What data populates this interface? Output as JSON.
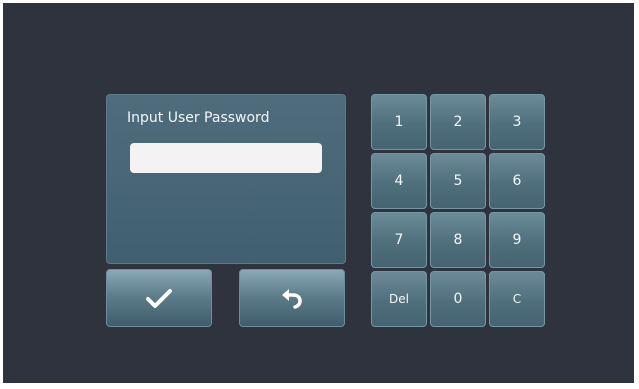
{
  "dialog": {
    "title": "Input User Password",
    "password_value": "",
    "password_placeholder": ""
  },
  "actions": {
    "confirm_icon": "checkmark-icon",
    "back_icon": "return-arrow-icon"
  },
  "keypad": {
    "keys": [
      "1",
      "2",
      "3",
      "4",
      "5",
      "6",
      "7",
      "8",
      "9",
      "Del",
      "0",
      "C"
    ]
  },
  "colors": {
    "background": "#2e333d",
    "panel": "#4a6878",
    "button": "#5e7e8c",
    "text": "#f2f6f8"
  }
}
